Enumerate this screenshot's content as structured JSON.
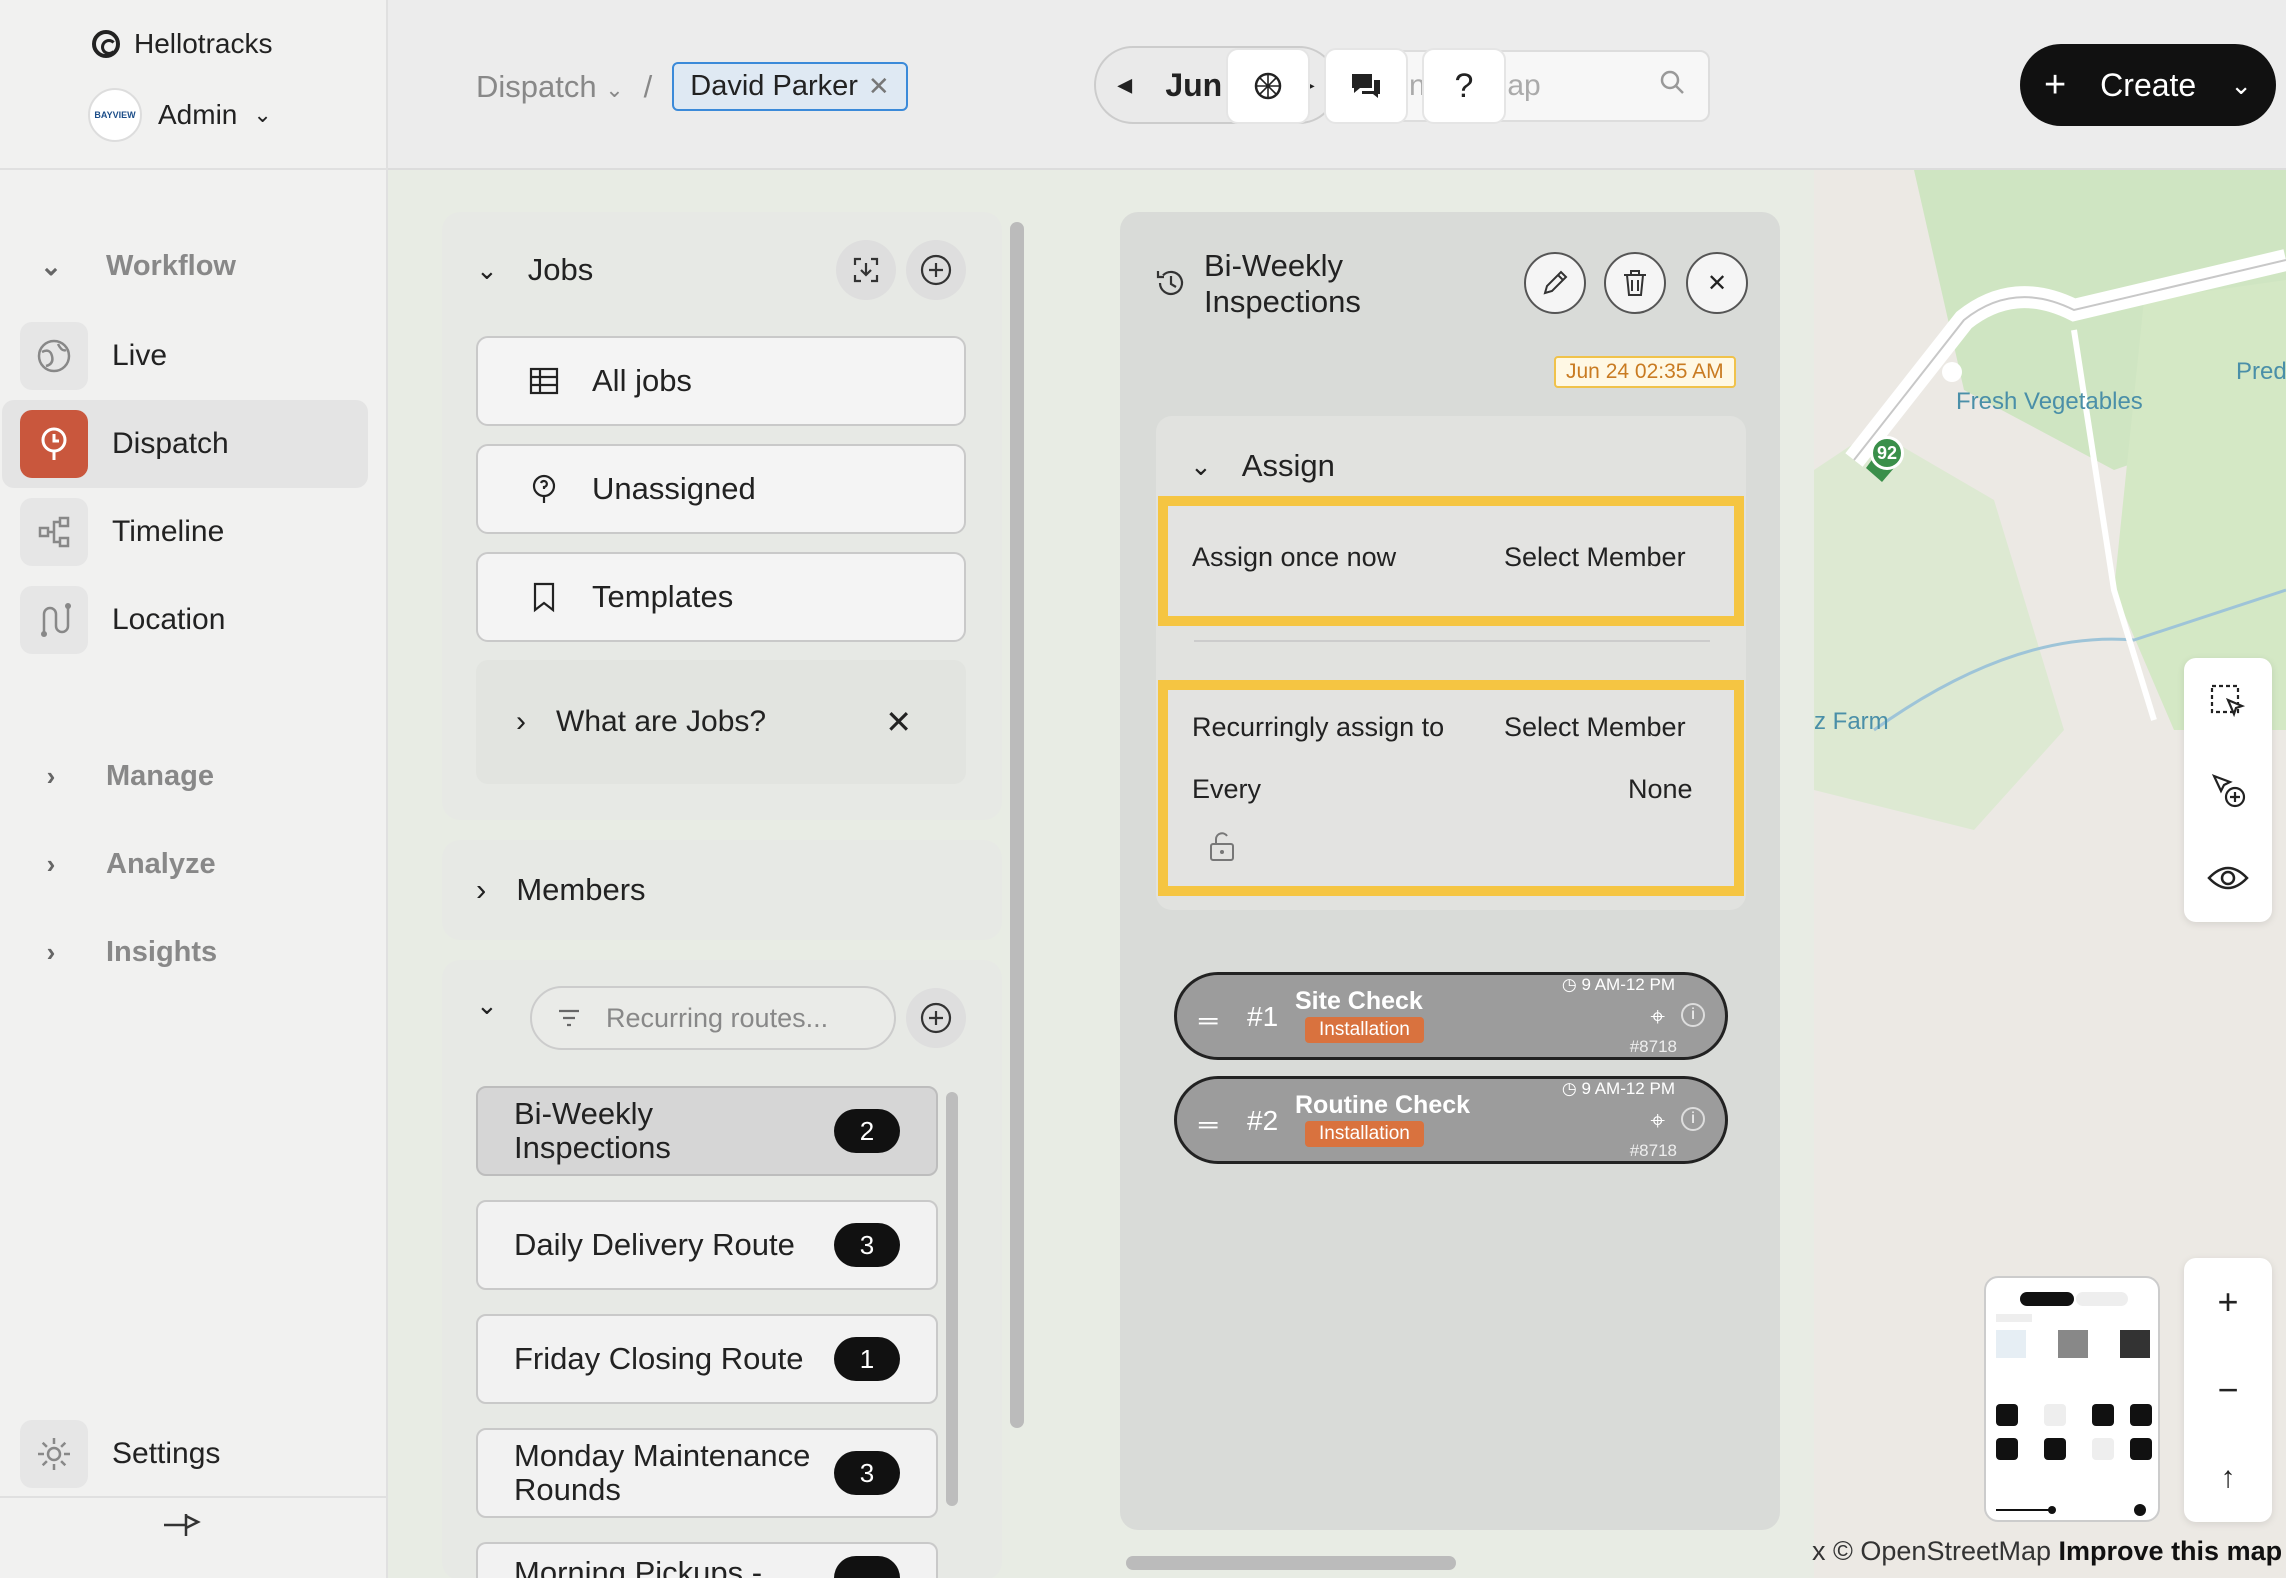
{
  "brand": {
    "name": "Hellotracks"
  },
  "org": {
    "role": "Admin",
    "avatar_text": "BAYVIEW"
  },
  "sidebar": {
    "sections": {
      "workflow": "Workflow",
      "manage": "Manage",
      "analyze": "Analyze",
      "insights": "Insights"
    },
    "items": [
      {
        "label": "Live",
        "icon": "globe-icon"
      },
      {
        "label": "Dispatch",
        "icon": "dispatch-icon",
        "active": true
      },
      {
        "label": "Timeline",
        "icon": "timeline-icon"
      },
      {
        "label": "Location",
        "icon": "route-icon"
      }
    ],
    "settings": "Settings"
  },
  "topbar": {
    "breadcrumb_root": "Dispatch",
    "separator": "/",
    "filter_chip": "David Parker",
    "date": "Jun 24",
    "search_placeholder": "Find in map",
    "help": "?",
    "create_label": "Create"
  },
  "jobs": {
    "title": "Jobs",
    "buttons": [
      "All jobs",
      "Unassigned",
      "Templates"
    ],
    "info_text": "What are Jobs?",
    "members_title": "Members",
    "routes_search_placeholder": "Recurring routes...",
    "routes": [
      {
        "name": "Bi-Weekly Inspections",
        "count": "2",
        "selected": true
      },
      {
        "name": "Daily Delivery Route",
        "count": "3"
      },
      {
        "name": "Friday Closing Route",
        "count": "1"
      },
      {
        "name": "Monday Maintenance Rounds",
        "count": "3"
      },
      {
        "name": "Morning Pickups -",
        "count": ""
      }
    ]
  },
  "detail": {
    "title": "Bi-Weekly Inspections",
    "timestamp": "Jun 24 02:35 AM",
    "assign_title": "Assign",
    "assign_once_label": "Assign once now",
    "assign_once_value": "Select Member",
    "recurring_label": "Recurringly assign to",
    "recurring_value": "Select Member",
    "every_label": "Every",
    "every_value": "None",
    "stops": [
      {
        "num": "#1",
        "name": "Site Check",
        "tag": "Installation",
        "time": "9 AM-12 PM",
        "code": "#8718"
      },
      {
        "num": "#2",
        "name": "Routine Check",
        "tag": "Installation",
        "time": "9 AM-12 PM",
        "code": "#8718"
      }
    ]
  },
  "map": {
    "labels": {
      "vegetables": "Fresh Vegetables",
      "farm": "z Farm",
      "pred": "Pred",
      "route": "92"
    },
    "attribution": "x © OpenStreetMap",
    "improve": "Improve this map"
  },
  "colors": {
    "accent": "#c9573d",
    "highlight": "#f5c542",
    "tag": "#d9723e",
    "chip_border": "#3b8ad9"
  }
}
